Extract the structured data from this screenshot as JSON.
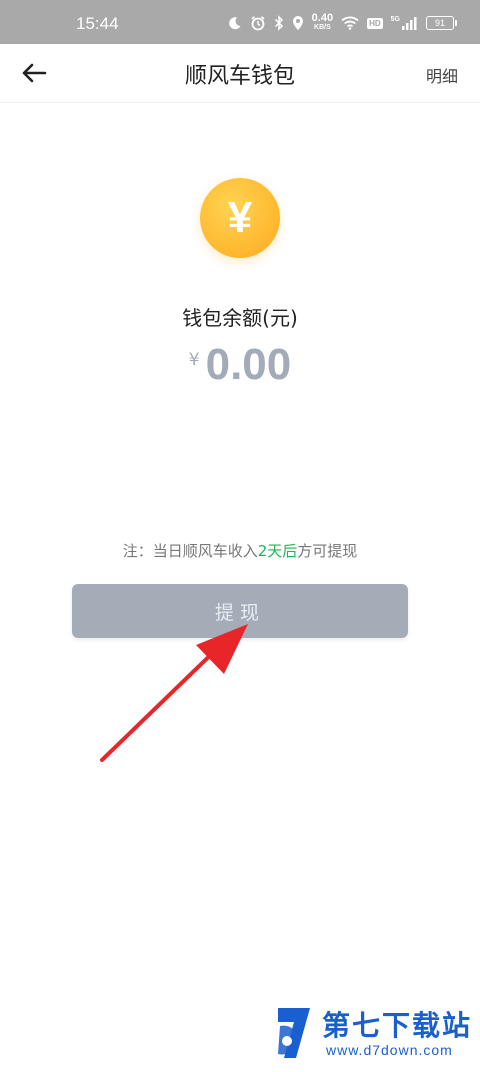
{
  "status_bar": {
    "time": "15:44",
    "net_speed_value": "0.40",
    "net_speed_unit": "KB/S",
    "hd_label": "HD",
    "signal_label": "5G",
    "battery": "91",
    "icons": [
      "moon-icon",
      "alarm-icon",
      "bluetooth-icon",
      "location-icon",
      "wifi-icon",
      "signal-icon",
      "battery-icon"
    ]
  },
  "header": {
    "back_icon": "arrow-left-icon",
    "title": "顺风车钱包",
    "detail_label": "明细"
  },
  "wallet": {
    "coin_icon": "yuan-coin-icon",
    "coin_symbol": "¥",
    "balance_label": "钱包余额(元)",
    "currency_symbol": "¥",
    "balance_amount": "0.00"
  },
  "notice": {
    "prefix": "注：当日顺风车收入",
    "highlight": "2天后",
    "suffix": "方可提现"
  },
  "withdraw_button": {
    "label": "提现"
  },
  "watermark": {
    "title": "第七下载站",
    "url": "www.d7down.com"
  },
  "colors": {
    "status_bar_bg": "#a9a9a9",
    "coin": "#ffb62e",
    "balance_text": "#a3abb8",
    "highlight_green": "#22b455",
    "button_bg": "#a4acb8",
    "annotation_arrow": "#e8262a",
    "watermark_blue": "#1a5fd0"
  }
}
